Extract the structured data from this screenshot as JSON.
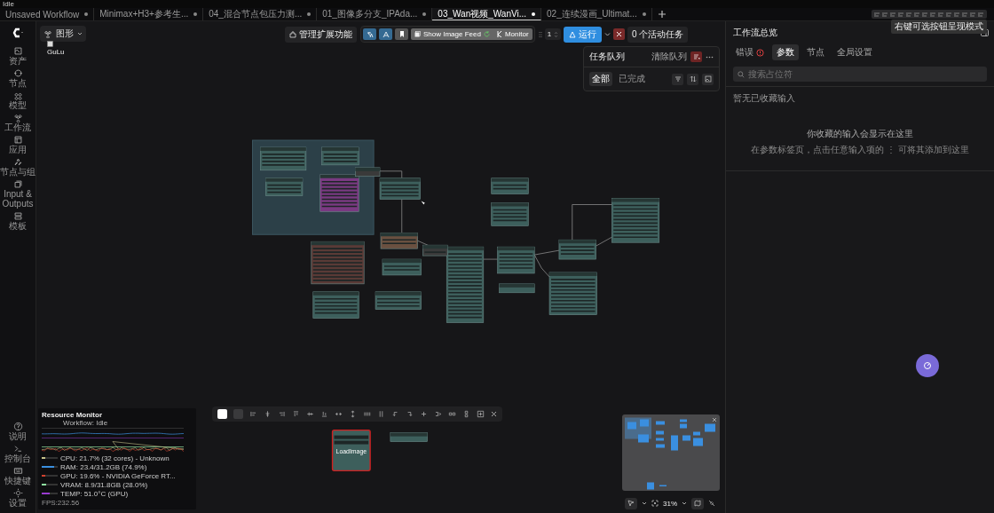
{
  "status": "Idle",
  "tabs": [
    {
      "label": "Unsaved Workflow",
      "selected": false
    },
    {
      "label": "Minimax+H3+参考生...",
      "selected": false
    },
    {
      "label": "04_混合节点包压力测...",
      "selected": false
    },
    {
      "label": "01_图像多分支_IPAda...",
      "selected": false
    },
    {
      "label": "03_Wan视频_WanVi...",
      "selected": true
    },
    {
      "label": "02_连续漫画_Ultimat...",
      "selected": false
    }
  ],
  "sidebar": {
    "items": [
      {
        "label": "资产"
      },
      {
        "label": "节点"
      },
      {
        "label": "模型"
      },
      {
        "label": "工作流"
      },
      {
        "label": "应用"
      },
      {
        "label": "节点与组"
      },
      {
        "label": "Input & Outputs"
      },
      {
        "label": "模板"
      }
    ],
    "bottom_items": [
      {
        "label": "说明"
      },
      {
        "label": "控制台"
      },
      {
        "label": "快捷键"
      },
      {
        "label": "设置"
      }
    ]
  },
  "canvas": {
    "view_mode": "图形",
    "broken_image_alt": "GuLu",
    "selected_node_title": "LoadImage"
  },
  "toolbar": {
    "manage_extensions": "管理扩展功能",
    "toggles": [
      {
        "kind": "translate",
        "selected": true
      },
      {
        "kind": "draw",
        "selected": true
      },
      {
        "kind": "bookmark",
        "selected": false
      }
    ],
    "image_feed": "Show Image Feed",
    "monitor": "Monitor",
    "batch_count": "1",
    "run": "运行",
    "active_tasks": "0 个活动任务"
  },
  "queue": {
    "title": "任务队列",
    "clear": "清除队列",
    "tabs": [
      {
        "label": "全部",
        "selected": true
      },
      {
        "label": "已完成",
        "selected": false
      }
    ]
  },
  "tooltip": "右键可选按钮呈现模式",
  "right_panel": {
    "title": "工作流总览",
    "tabs": [
      {
        "label": "错误",
        "selected": false,
        "has_error": true
      },
      {
        "label": "参数",
        "selected": true,
        "has_error": false
      },
      {
        "label": "节点",
        "selected": false,
        "has_error": false
      },
      {
        "label": "全局设置",
        "selected": false,
        "has_error": false
      }
    ],
    "search_placeholder": "搜索占位符",
    "empty_title": "暂无已收藏输入",
    "empty_message": "你收藏的输入会显示在这里",
    "hint": "在参数标签页，点击任意输入项的 ⋮ 可将其添加到这里"
  },
  "resource_monitor": {
    "title": "Resource Monitor",
    "workflow": "Workflow: Idle",
    "stats": [
      {
        "label": "CPU: 21.7% (32 cores) - Unknown",
        "color": "#c8c48a",
        "level": 0.22
      },
      {
        "label": "RAM: 23.4/31.2GB (74.9%)",
        "color": "#3a8fe0",
        "level": 0.75
      },
      {
        "label": "GPU: 19.6% - NVIDIA GeForce RT...",
        "color": "#d0412e",
        "level": 0.2
      },
      {
        "label": "VRAM: 8.9/31.8GB (28.0%)",
        "color": "#8ee0a0",
        "level": 0.28
      },
      {
        "label": "TEMP: 51.0°C (GPU)",
        "color": "#9a3ad0",
        "level": 0.51
      }
    ],
    "fps": "FPS:232.56"
  },
  "minimap": {
    "zoom": "31%"
  }
}
